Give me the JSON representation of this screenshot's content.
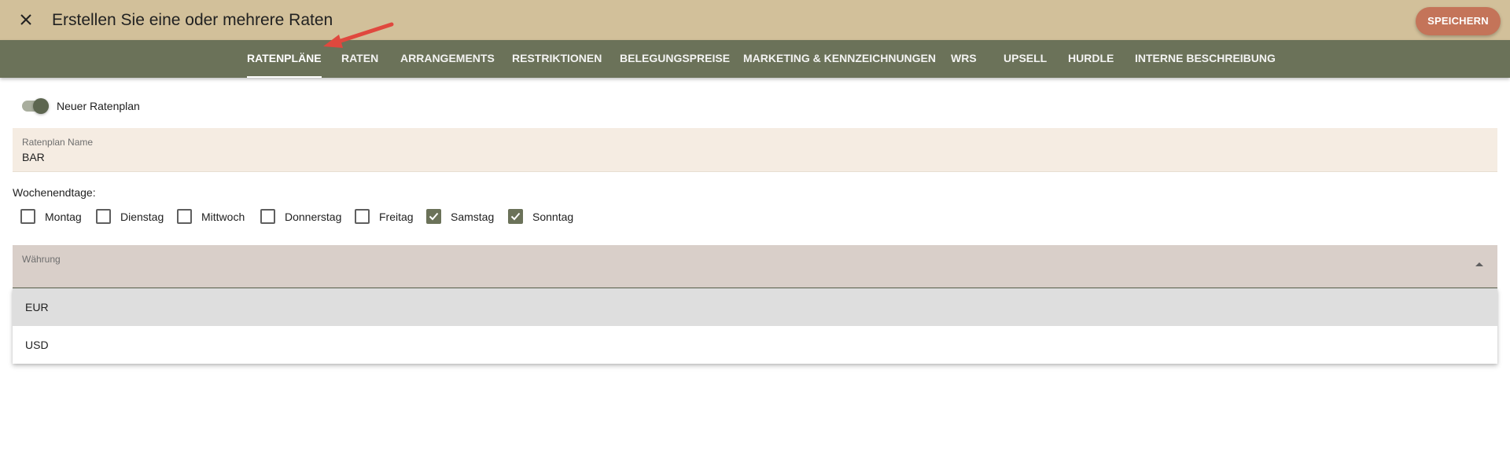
{
  "header": {
    "title": "Erstellen Sie eine oder mehrere Raten",
    "save_label": "SPEICHERN",
    "close_icon": "close-icon"
  },
  "tabs": [
    {
      "label": "RATENPLÄNE",
      "active": true
    },
    {
      "label": "RATEN",
      "active": false
    },
    {
      "label": "ARRANGEMENTS",
      "active": false
    },
    {
      "label": "RESTRIKTIONEN",
      "active": false
    },
    {
      "label": "BELEGUNGSPREISE",
      "active": false
    },
    {
      "label": "MARKETING & KENNZEICHNUNGEN",
      "active": false
    },
    {
      "label": "WRS",
      "active": false
    },
    {
      "label": "UPSELL",
      "active": false
    },
    {
      "label": "HURDLE",
      "active": false
    },
    {
      "label": "INTERNE BESCHREIBUNG",
      "active": false
    }
  ],
  "form": {
    "new_rateplan_toggle": {
      "label": "Neuer Ratenplan",
      "on": true
    },
    "rateplan_name": {
      "label": "Ratenplan Name",
      "value": "BAR"
    },
    "weekend_days": {
      "label": "Wochenendtage:",
      "days": [
        {
          "label": "Montag",
          "checked": false
        },
        {
          "label": "Dienstag",
          "checked": false
        },
        {
          "label": "Mittwoch",
          "checked": false
        },
        {
          "label": "Donnerstag",
          "checked": false
        },
        {
          "label": "Freitag",
          "checked": false
        },
        {
          "label": "Samstag",
          "checked": true
        },
        {
          "label": "Sonntag",
          "checked": true
        }
      ]
    },
    "currency": {
      "label": "Währung",
      "open": true,
      "options": [
        {
          "label": "EUR",
          "highlighted": true
        },
        {
          "label": "USD",
          "highlighted": false
        }
      ]
    }
  },
  "colors": {
    "header_bg": "#d2c09a",
    "tabbar_bg": "#6b7259",
    "save_button": "#c47459",
    "annotation_arrow": "#e0483e"
  }
}
